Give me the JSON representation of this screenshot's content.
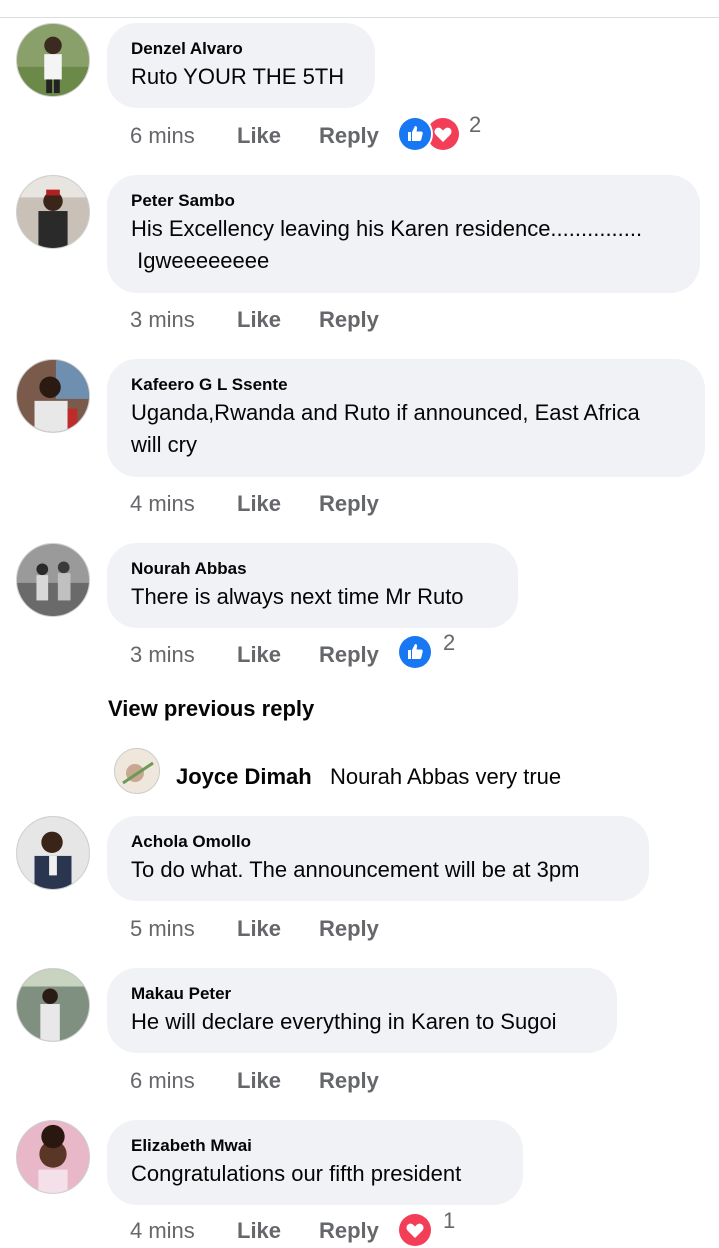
{
  "comments": [
    {
      "author": "Denzel Alvaro",
      "text": "Ruto YOUR THE 5TH",
      "time": "6 mins",
      "like": "Like",
      "reply": "Reply",
      "reaction_count": "2",
      "reactions": [
        "like-icon",
        "love-icon"
      ]
    },
    {
      "author": "Peter Sambo",
      "text": "His Excellency leaving his Karen residence...............\n Igweeeeeeee",
      "time": "3 mins",
      "like": "Like",
      "reply": "Reply"
    },
    {
      "author": "Kafeero G L Ssente",
      "text": "Uganda,Rwanda and Ruto if announced, East Africa\nwill cry",
      "time": "4 mins",
      "like": "Like",
      "reply": "Reply"
    },
    {
      "author": "Nourah Abbas",
      "text": "There is always next time Mr Ruto",
      "time": "3 mins",
      "like": "Like",
      "reply": "Reply",
      "reaction_count": "2",
      "reactions": [
        "like-icon"
      ]
    },
    {
      "author": "Achola Omollo",
      "text": "To do what. The announcement will be at 3pm",
      "time": "5 mins",
      "like": "Like",
      "reply": "Reply"
    },
    {
      "author": "Makau Peter",
      "text": "He will declare everything in Karen to Sugoi",
      "time": "6 mins",
      "like": "Like",
      "reply": "Reply"
    },
    {
      "author": "Elizabeth Mwai",
      "text": "Congratulations our fifth president",
      "time": "4 mins",
      "like": "Like",
      "reply": "Reply",
      "reaction_count": "1",
      "reactions": [
        "love-icon"
      ]
    }
  ],
  "view_previous": "View previous reply",
  "subreply": {
    "author": "Joyce Dimah",
    "text": "Nourah Abbas very true"
  },
  "colors": {
    "bubble": "#f0f2f5",
    "like_blue": "#1877f2",
    "love_red": "#f33e58",
    "meta_gray": "#65676b"
  }
}
